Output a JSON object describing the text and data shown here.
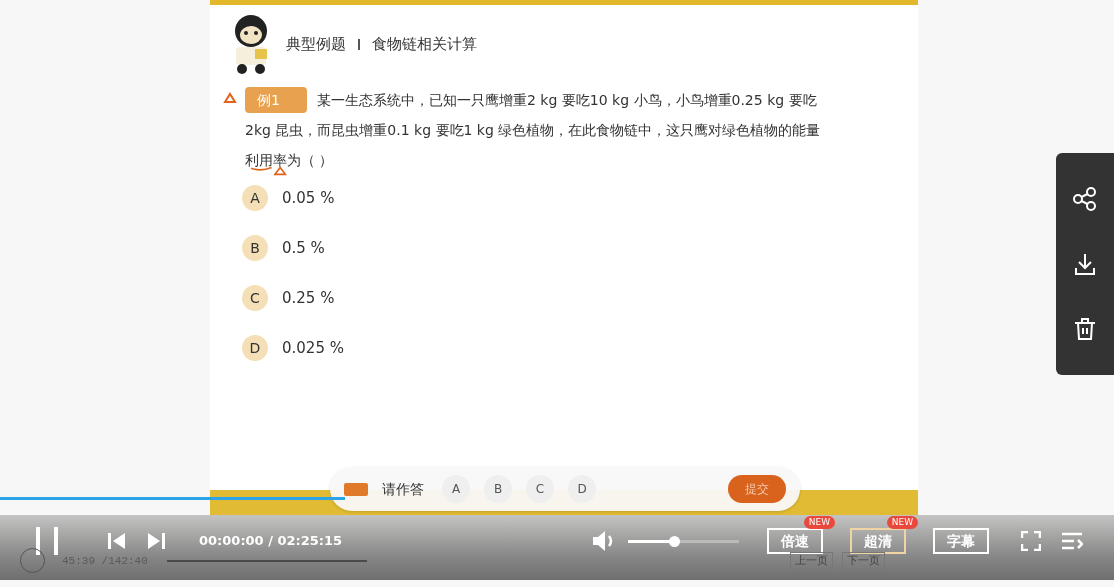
{
  "slide": {
    "section": "典型例题",
    "topic": "食物链相关计算",
    "example_tag": "例1",
    "question_lines": [
      "某一生态系统中，已知一只鹰增重2 kg 要吃10 kg 小鸟，小鸟增重0.25 kg 要吃",
      "2kg 昆虫，而昆虫增重0.1 kg 要吃1 kg 绿色植物，在此食物链中，这只鹰对绿色植物的能量",
      "利用率为（  ）"
    ],
    "options": [
      {
        "letter": "A",
        "text": "0.05 %"
      },
      {
        "letter": "B",
        "text": "0.5 %"
      },
      {
        "letter": "C",
        "text": "0.25 %"
      },
      {
        "letter": "D",
        "text": "0.025 %"
      }
    ]
  },
  "answer_bar": {
    "prompt": "请作答",
    "choices": [
      {
        "label": "A",
        "selected": false
      },
      {
        "label": "B",
        "selected": false
      },
      {
        "label": "C",
        "selected": false
      },
      {
        "label": "D",
        "selected": false
      }
    ],
    "submit": "提交"
  },
  "player": {
    "progress": {
      "level": 0.31
    },
    "time": "00:00:00 / 02:25:15",
    "old_time": "45:39 /142:40",
    "volume": {
      "level": 0.41
    },
    "buttons": [
      {
        "label": "倍速",
        "badge": "NEW",
        "highlighted": false
      },
      {
        "label": "超清",
        "badge": "NEW",
        "highlighted": true
      },
      {
        "label": "字幕",
        "highlighted": false
      }
    ],
    "page_buttons": [
      "上一页",
      "下一页"
    ]
  }
}
